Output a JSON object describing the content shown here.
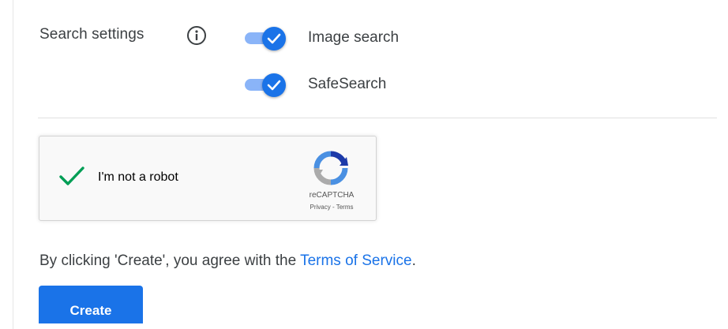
{
  "settings": {
    "label": "Search settings",
    "info_icon": "info-icon",
    "toggles": [
      {
        "label": "Image search",
        "checked": true
      },
      {
        "label": "SafeSearch",
        "checked": true
      }
    ],
    "accent_color": "#1a73e8",
    "track_color": "#8ab4f8"
  },
  "recaptcha": {
    "checkbox_label": "I'm not a robot",
    "checked": true,
    "brand": "reCAPTCHA",
    "privacy": "Privacy",
    "separator": " - ",
    "terms": "Terms",
    "check_color": "#009e55"
  },
  "agreement": {
    "prefix": "By clicking 'Create', you agree with the ",
    "link_text": "Terms of Service",
    "suffix": "."
  },
  "create_button": {
    "label": "Create"
  }
}
